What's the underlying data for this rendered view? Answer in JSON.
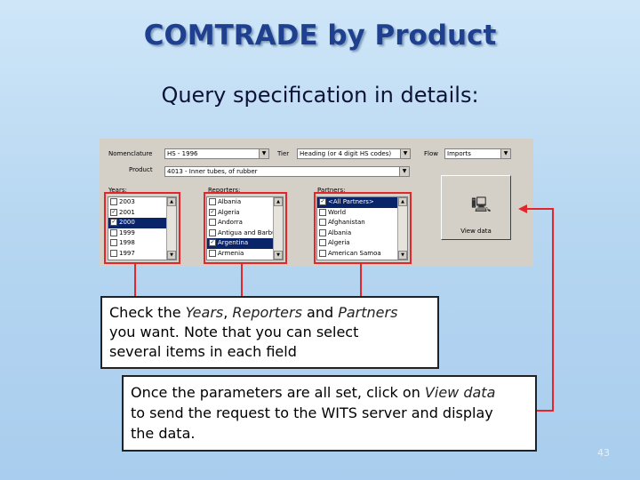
{
  "slide": {
    "title": "COMTRADE by Product",
    "subtitle": "Query specification in details:",
    "page_number": "43"
  },
  "dialog": {
    "nomenclature_label": "Nomenclature",
    "nomenclature_value": "HS - 1996",
    "tier_label": "Tier",
    "tier_value": "Heading (or 4 digit HS codes)",
    "flow_label": "Flow",
    "flow_value": "Imports",
    "product_label": "Product",
    "product_value": "4013 - Inner tubes, of rubber",
    "years_label": "Years:",
    "years": [
      {
        "label": "2003",
        "checked": false,
        "selected": false
      },
      {
        "label": "2001",
        "checked": true,
        "selected": false
      },
      {
        "label": "2000",
        "checked": true,
        "selected": true
      },
      {
        "label": "1999",
        "checked": false,
        "selected": false
      },
      {
        "label": "1998",
        "checked": false,
        "selected": false
      },
      {
        "label": "1997",
        "checked": false,
        "selected": false
      }
    ],
    "reporters_label": "Reporters:",
    "reporters": [
      {
        "label": "Albania",
        "checked": false,
        "selected": false
      },
      {
        "label": "Algeria",
        "checked": true,
        "selected": false
      },
      {
        "label": "Andorra",
        "checked": false,
        "selected": false
      },
      {
        "label": "Antigua and Barbuda",
        "checked": false,
        "selected": false
      },
      {
        "label": "Argentina",
        "checked": true,
        "selected": true
      },
      {
        "label": "Armenia",
        "checked": false,
        "selected": false
      }
    ],
    "partners_label": "Partners:",
    "partners": [
      {
        "label": "<All Partners>",
        "checked": true,
        "selected": true
      },
      {
        "label": "World",
        "checked": false,
        "selected": false
      },
      {
        "label": "Afghanistan",
        "checked": false,
        "selected": false
      },
      {
        "label": "Albania",
        "checked": false,
        "selected": false
      },
      {
        "label": "Algeria",
        "checked": false,
        "selected": false
      },
      {
        "label": "American Samoa",
        "checked": false,
        "selected": false
      }
    ],
    "view_data_label": "View data",
    "view_icon": "computer-icon"
  },
  "callout1": {
    "pre": "Check the ",
    "years": "Years",
    "sep": ", ",
    "reporters": "Reporters",
    "and": " and ",
    "partners": "Partners",
    "line2": "you want. Note that you can select",
    "line3": "several items in each field"
  },
  "callout2": {
    "pre": "Once the parameters are all set, click on ",
    "view_data": "View data",
    "line2": "to send the request to the WITS server and display",
    "line3": "the data."
  },
  "colors": {
    "accent_red": "#e3262b",
    "title_blue": "#1f3f8f",
    "selection": "#0a246a"
  }
}
